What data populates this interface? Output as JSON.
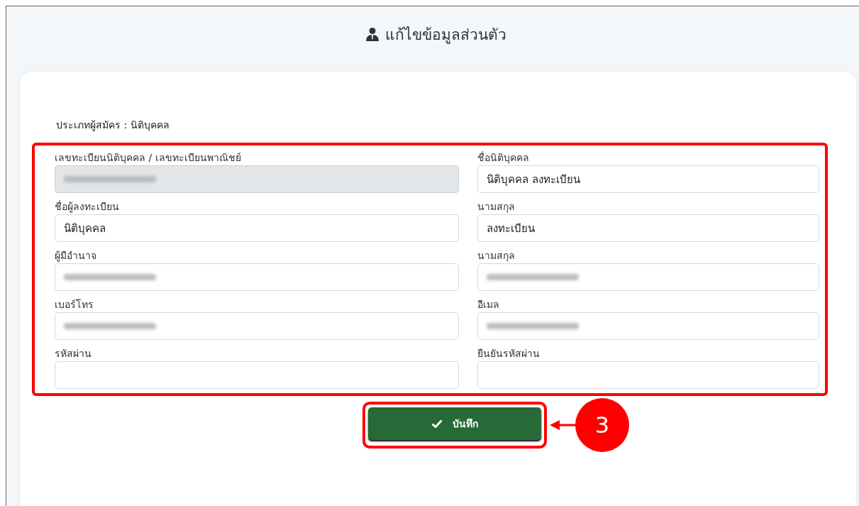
{
  "page": {
    "title": "แก้ไขข้อมูลส่วนตัว"
  },
  "applicant_type": {
    "label": "ประเภทผู้สมัคร :",
    "value": "นิติบุคคล"
  },
  "fields": [
    {
      "label": "เลขทะเบียนนิติบุคคล / เลขทะเบียนพาณิชย์",
      "kind": "redacted",
      "disabled": true
    },
    {
      "label": "ชื่อนิติบุคคล",
      "kind": "text",
      "value": "นิติบุคคล ลงทะเบียน",
      "disabled": false
    },
    {
      "label": "ชื่อผู้ลงทะเบียน",
      "kind": "text",
      "value": "นิติบุคคล",
      "disabled": false
    },
    {
      "label": "นามสกุล",
      "kind": "text",
      "value": "ลงทะเบียน",
      "disabled": false
    },
    {
      "label": "ผู้มีอำนาจ",
      "kind": "redacted",
      "disabled": false
    },
    {
      "label": "นามสกุล",
      "kind": "redacted",
      "disabled": false
    },
    {
      "label": "เบอร์โทร",
      "kind": "redacted",
      "disabled": false
    },
    {
      "label": "อีเมล",
      "kind": "redacted",
      "disabled": false
    },
    {
      "label": "รหัสผ่าน",
      "kind": "empty",
      "disabled": false
    },
    {
      "label": "ยืนยันรหัสผ่าน",
      "kind": "empty",
      "disabled": false
    }
  ],
  "save_button": {
    "label": "บันทึก"
  },
  "annotation": {
    "step": "3"
  }
}
